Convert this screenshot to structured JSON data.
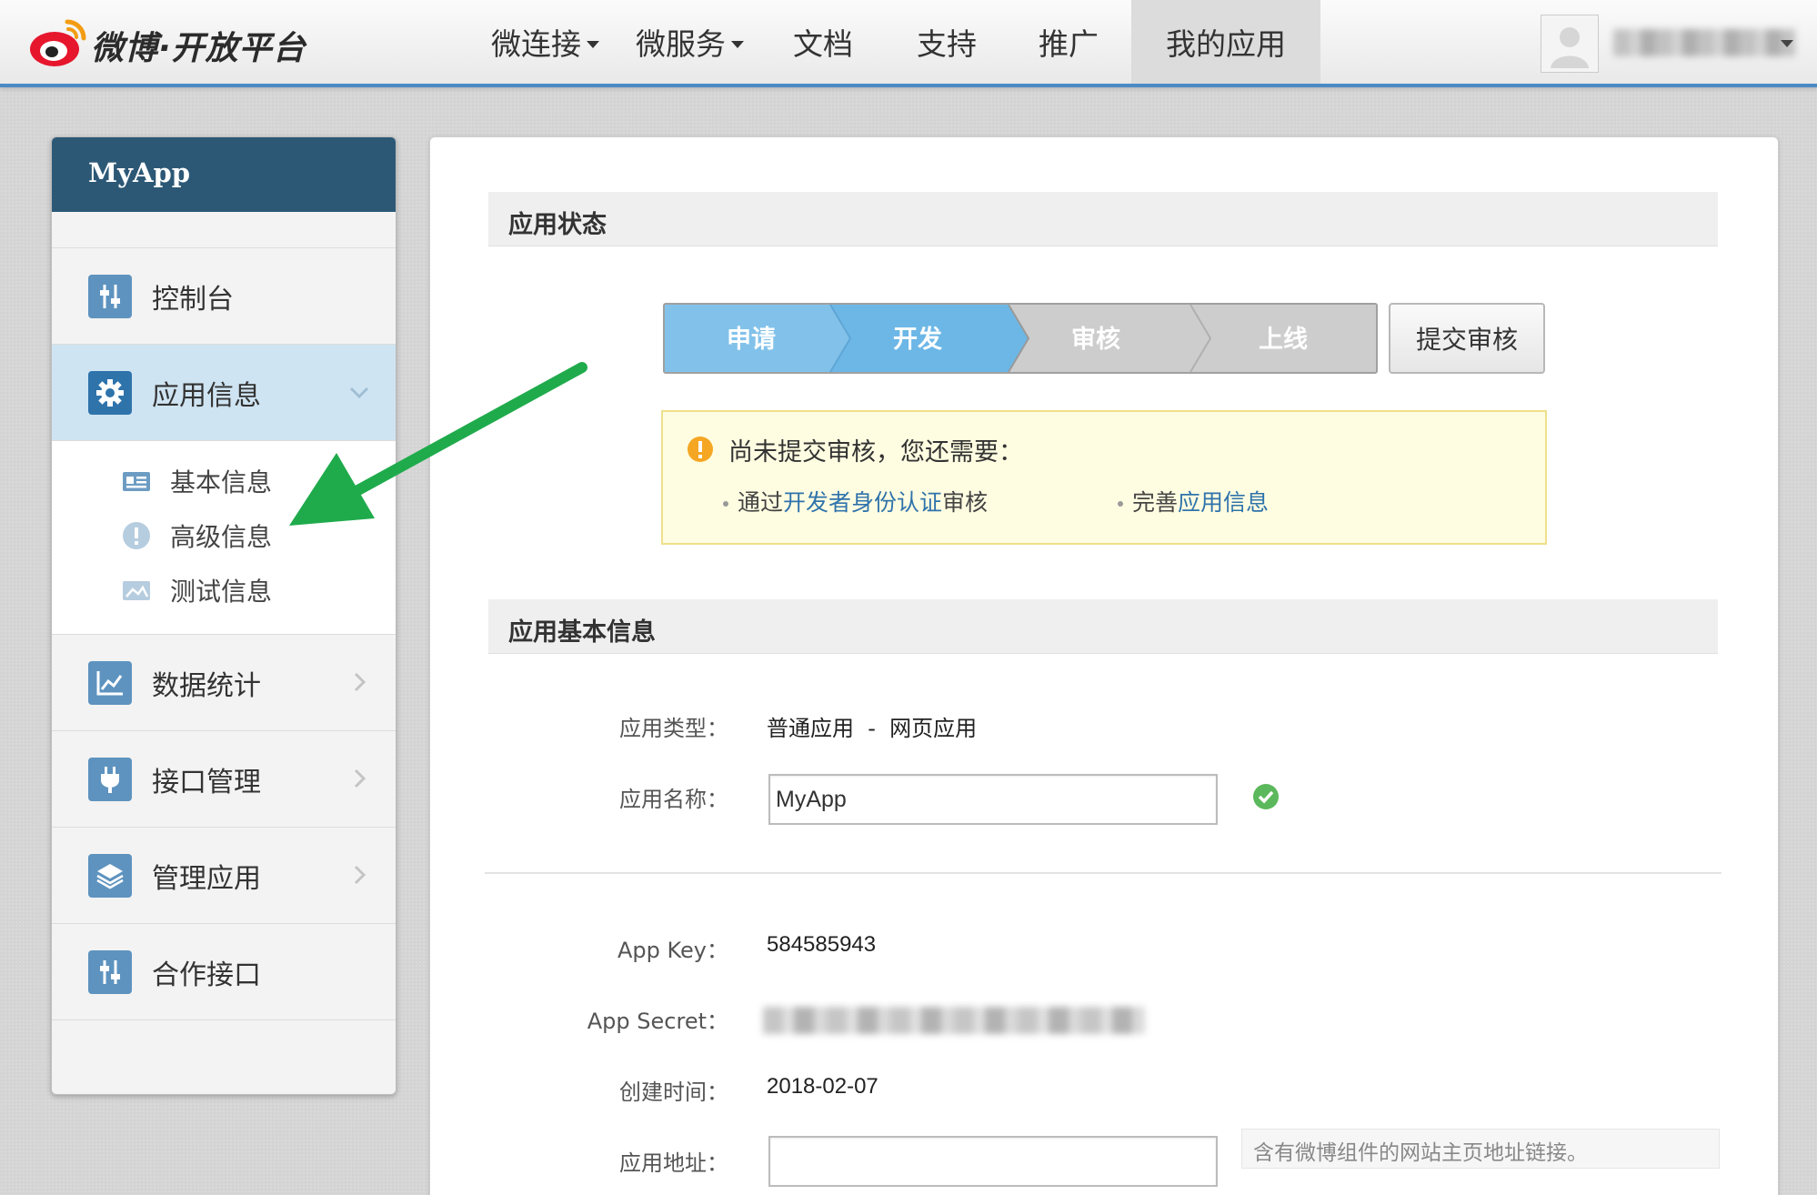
{
  "header": {
    "logo_text": "微博·开放平台",
    "nav": [
      {
        "label": "微连接",
        "has_caret": true
      },
      {
        "label": "微服务",
        "has_caret": true
      },
      {
        "label": "文档",
        "has_caret": false
      },
      {
        "label": "支持",
        "has_caret": false
      },
      {
        "label": "推广",
        "has_caret": false
      },
      {
        "label": "我的应用",
        "has_caret": false,
        "active": true
      }
    ]
  },
  "sidebar": {
    "app_name": "MyApp",
    "items": [
      {
        "label": "控制台",
        "icon": "sliders-icon"
      },
      {
        "label": "应用信息",
        "icon": "gear-icon",
        "active": true,
        "expanded": true
      },
      {
        "label": "数据统计",
        "icon": "chart-icon"
      },
      {
        "label": "接口管理",
        "icon": "plug-icon"
      },
      {
        "label": "管理应用",
        "icon": "layers-icon"
      },
      {
        "label": "合作接口",
        "icon": "sliders-icon"
      }
    ],
    "sub_items": [
      {
        "label": "基本信息",
        "icon": "id-card-icon"
      },
      {
        "label": "高级信息",
        "icon": "exclamation-icon"
      },
      {
        "label": "测试信息",
        "icon": "image-card-icon"
      }
    ]
  },
  "status_section": {
    "title": "应用状态",
    "steps": [
      "申请",
      "开发",
      "审核",
      "上线"
    ],
    "completed_steps": 2,
    "submit_button": "提交审核",
    "notice": {
      "title": "尚未提交审核，您还需要：",
      "item1_prefix": "通过",
      "item1_link": "开发者身份认证",
      "item1_suffix": "审核",
      "item2_prefix": "完善",
      "item2_link": "应用信息"
    }
  },
  "basic_section": {
    "title": "应用基本信息",
    "type_label": "应用类型：",
    "type_value": "普通应用  -  网页应用",
    "name_label": "应用名称：",
    "name_value": "MyApp",
    "appkey_label": "App Key：",
    "appkey_value": "584585943",
    "appsecret_label": "App Secret：",
    "created_label": "创建时间：",
    "created_value": "2018-02-07",
    "url_label": "应用地址：",
    "url_value": "",
    "url_hint": "含有微博组件的网站主页地址链接。"
  },
  "colors": {
    "sidebar_header": "#2c5876",
    "active_item_bg": "#cfe4f2",
    "step_done": "#7ebfe8",
    "step_todo": "#cfcfcf",
    "link": "#2f73ab",
    "annotation_arrow": "#1fab4c"
  }
}
